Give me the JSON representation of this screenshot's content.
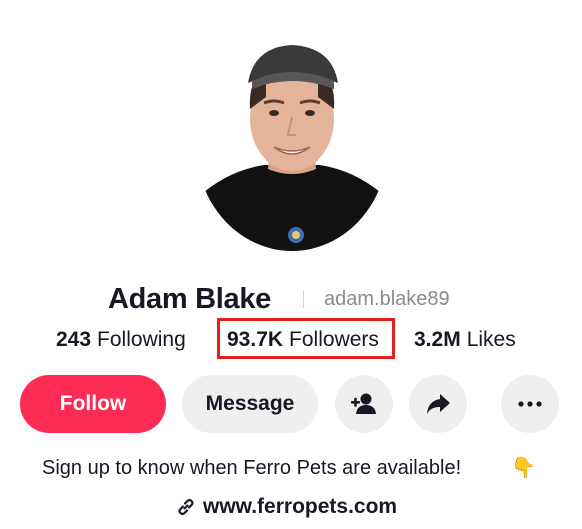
{
  "profile": {
    "display_name": "Adam Blake",
    "username": "adam.blake89",
    "avatar_alt": "profile photo"
  },
  "stats": {
    "following_count": "243",
    "following_label": "Following",
    "followers_count": "93.7K",
    "followers_label": "Followers",
    "likes_count": "3.2M",
    "likes_label": "Likes"
  },
  "actions": {
    "follow_label": "Follow",
    "message_label": "Message",
    "add_friend_icon": "add-user-icon",
    "share_icon": "share-icon",
    "more_icon": "more-icon"
  },
  "bio": {
    "text": "Sign up to know when Ferro Pets are available!",
    "emoji": "👇"
  },
  "link": {
    "icon": "link-icon",
    "url": "www.ferropets.com"
  },
  "colors": {
    "follow_button": "#fe2c55",
    "secondary_button": "#efeff0",
    "highlight_box": "#e51e1e",
    "username_gray": "#8a8b91"
  }
}
